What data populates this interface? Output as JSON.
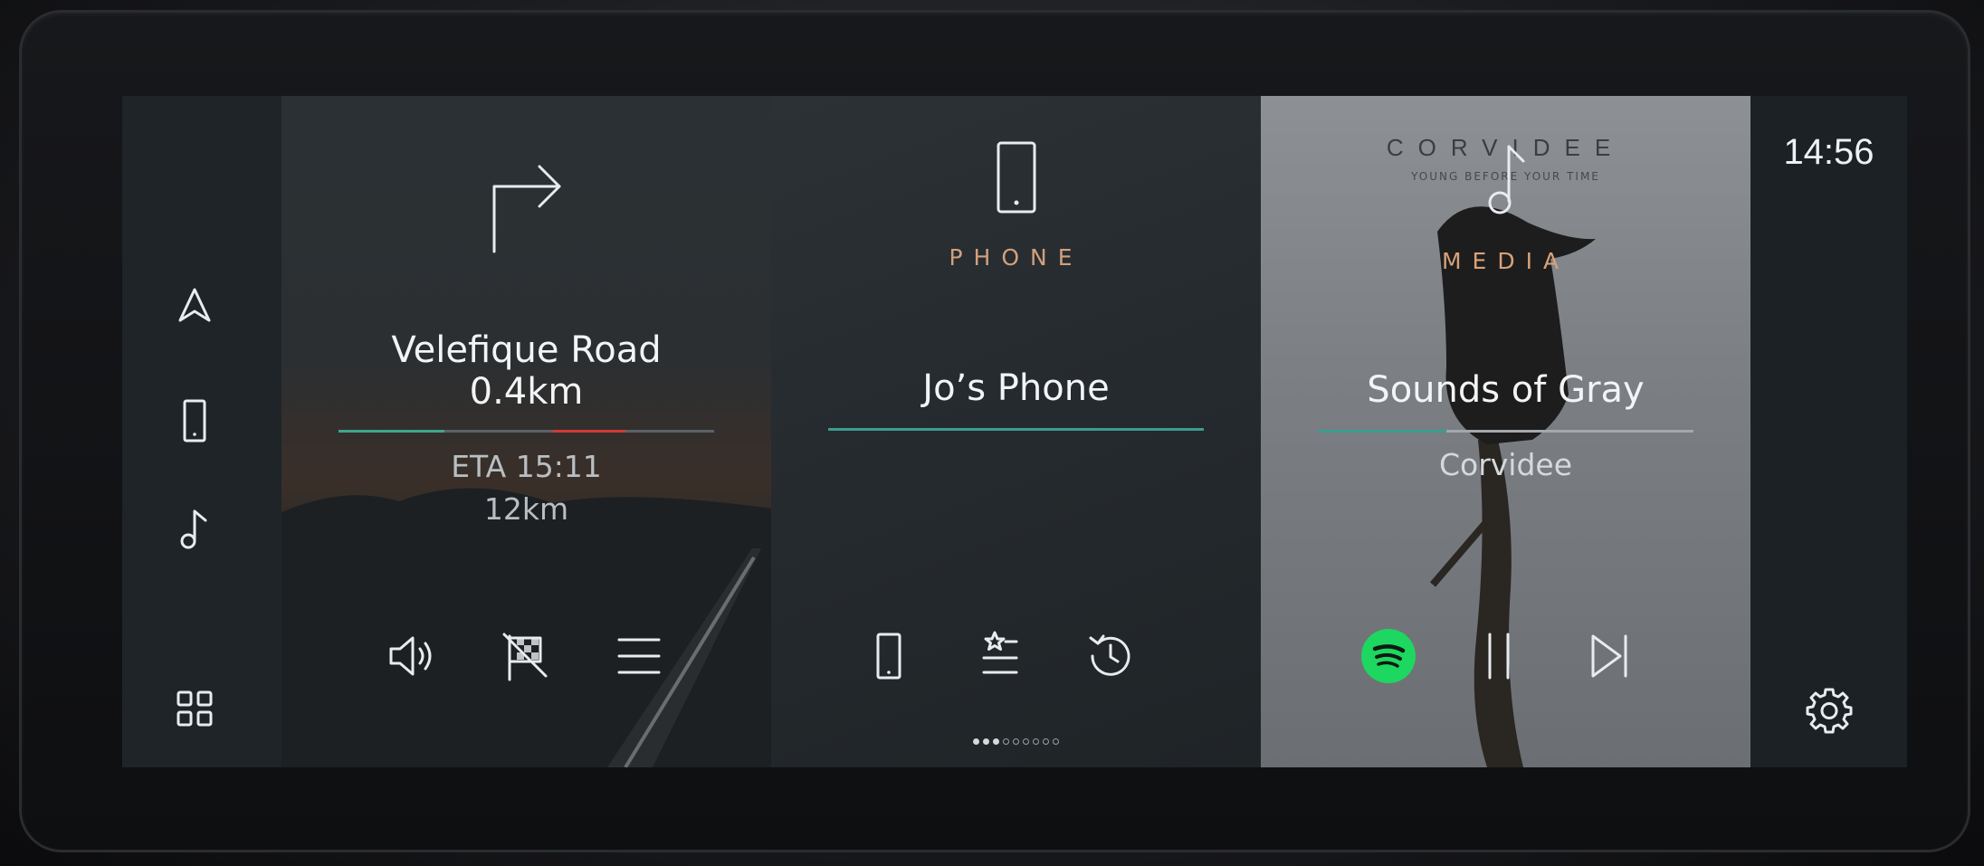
{
  "clock": "14:56",
  "navigation": {
    "street": "Velefique Road",
    "distance": "0.4km",
    "eta": "ETA 15:11",
    "remaining": "12km"
  },
  "phone": {
    "label": "PHONE",
    "device": "Jo’s Phone",
    "page_indicator": {
      "current": 3,
      "total": 9
    }
  },
  "media": {
    "label": "MEDIA",
    "album_brand": "CORVIDEE",
    "album_tagline": "YOUNG BEFORE YOUR TIME",
    "track": "Sounds of Gray",
    "artist": "Corvidee",
    "source_color": "#1ed760"
  },
  "colors": {
    "progress_teal": "#3fa58f",
    "progress_red": "#d23a35",
    "phone_teal": "#3c9c8e",
    "media_label": "#d7a27a",
    "phone_label": "#d2a07c"
  }
}
